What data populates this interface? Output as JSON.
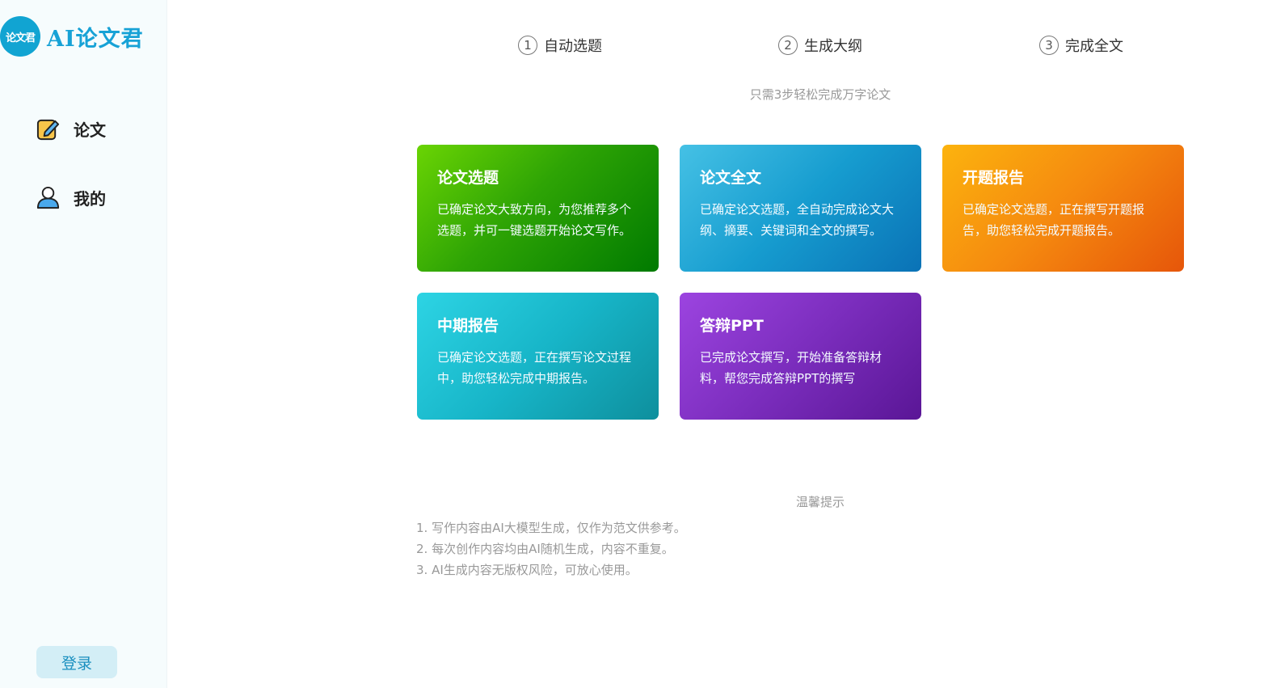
{
  "sidebar": {
    "logo_badge": "论文君",
    "logo_text": "AI论文君",
    "nav": [
      {
        "label": "论文",
        "icon": "edit-note-icon"
      },
      {
        "label": "我的",
        "icon": "user-icon"
      }
    ],
    "login_label": "登录"
  },
  "steps": [
    {
      "num": "1",
      "label": "自动选题"
    },
    {
      "num": "2",
      "label": "生成大纲"
    },
    {
      "num": "3",
      "label": "完成全文"
    }
  ],
  "subtitle": "只需3步轻松完成万字论文",
  "cards": [
    {
      "title": "论文选题",
      "desc": "已确定论文大致方向，为您推荐多个选题，并可一键选题开始论文写作。",
      "color": "#2ea405"
    },
    {
      "title": "论文全文",
      "desc": "已确定论文选题，全自动完成论文大纲、摘要、关键词和全文的撰写。",
      "color": "#169ccf"
    },
    {
      "title": "开题报告",
      "desc": "已确定论文选题，正在撰写开题报告，助您轻松完成开题报告。",
      "color": "#f5890f"
    },
    {
      "title": "中期报告",
      "desc": "已确定论文选题，正在撰写论文过程中，助您轻松完成中期报告。",
      "color": "#17b5c8"
    },
    {
      "title": "答辩PPT",
      "desc": "已完成论文撰写，开始准备答辩材料，帮您完成答辩PPT的撰写",
      "color": "#7b2dbd"
    }
  ],
  "tips": {
    "title": "温馨提示",
    "items": [
      "1. 写作内容由AI大模型生成，仅作为范文供参考。",
      "2. 每次创作内容均由AI随机生成，内容不重复。",
      "3. AI生成内容无版权风险，可放心使用。"
    ]
  }
}
